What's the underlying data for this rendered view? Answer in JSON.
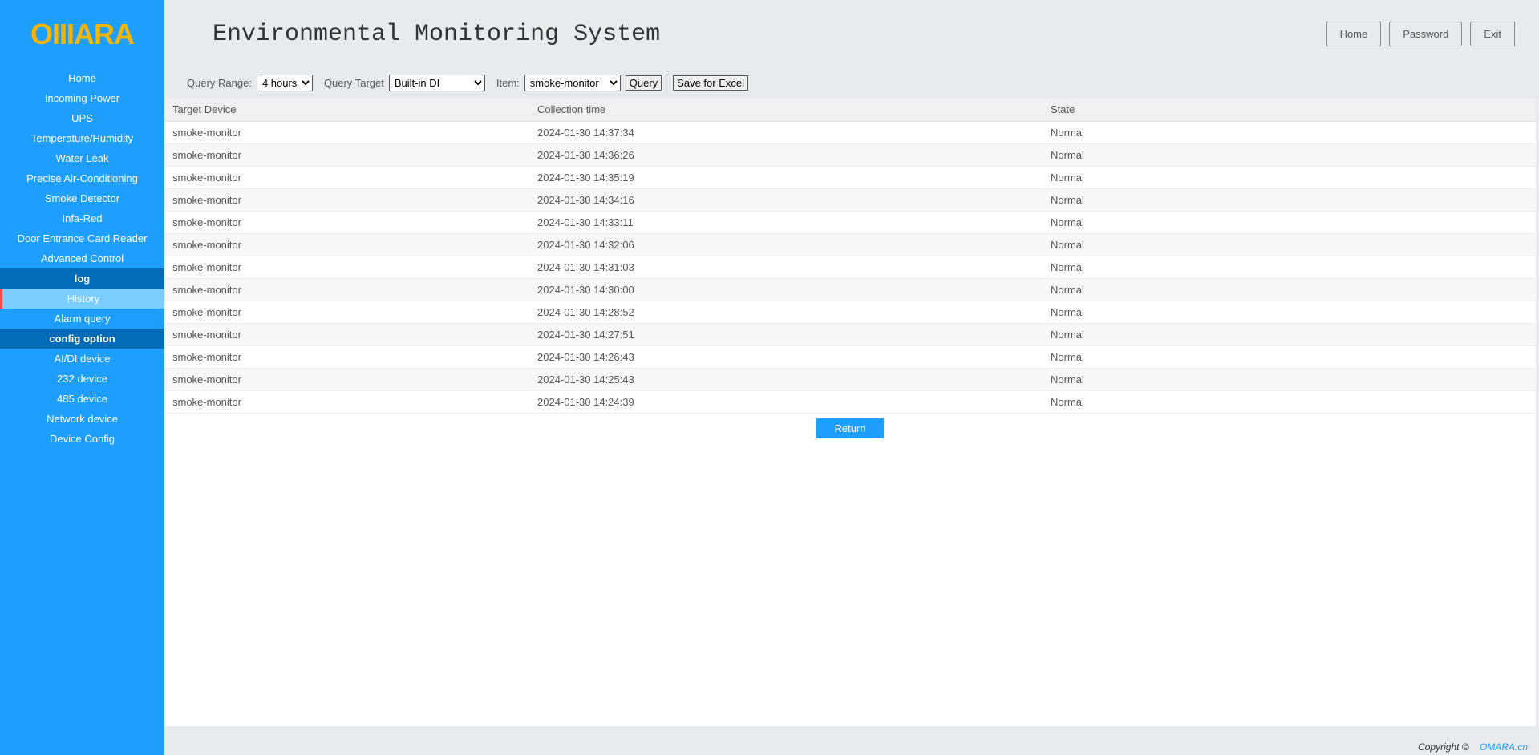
{
  "logo_text": "OIIIARA",
  "page_title": "Environmental Monitoring System",
  "header_buttons": {
    "home": "Home",
    "password": "Password",
    "exit": "Exit"
  },
  "sidebar": {
    "items": [
      {
        "label": "Home",
        "type": "item"
      },
      {
        "label": "Incoming Power",
        "type": "item"
      },
      {
        "label": "UPS",
        "type": "item"
      },
      {
        "label": "Temperature/Humidity",
        "type": "item"
      },
      {
        "label": "Water Leak",
        "type": "item"
      },
      {
        "label": "Precise Air-Conditioning",
        "type": "item"
      },
      {
        "label": "Smoke Detector",
        "type": "item"
      },
      {
        "label": "Infa-Red",
        "type": "item"
      },
      {
        "label": "Door Entrance Card Reader",
        "type": "item"
      },
      {
        "label": "Advanced Control",
        "type": "item"
      },
      {
        "label": "log",
        "type": "section"
      },
      {
        "label": "History",
        "type": "active"
      },
      {
        "label": "Alarm query",
        "type": "item"
      },
      {
        "label": "config option",
        "type": "section"
      },
      {
        "label": "AI/DI device",
        "type": "item"
      },
      {
        "label": "232 device",
        "type": "item"
      },
      {
        "label": "485 device",
        "type": "item"
      },
      {
        "label": "Network device",
        "type": "item"
      },
      {
        "label": "Device Config",
        "type": "item"
      }
    ]
  },
  "query": {
    "range_label": "Query Range:",
    "range_value": "4 hours",
    "target_label": "Query Target",
    "target_value": "Built-in DI",
    "item_label": "Item:",
    "item_value": "smoke-monitor",
    "query_btn": "Query",
    "save_btn": "Save for Excel"
  },
  "table": {
    "headers": {
      "device": "Target Device",
      "time": "Collection time",
      "state": "State"
    },
    "rows": [
      {
        "device": "smoke-monitor",
        "time": "2024-01-30 14:37:34",
        "state": "Normal"
      },
      {
        "device": "smoke-monitor",
        "time": "2024-01-30 14:36:26",
        "state": "Normal"
      },
      {
        "device": "smoke-monitor",
        "time": "2024-01-30 14:35:19",
        "state": "Normal"
      },
      {
        "device": "smoke-monitor",
        "time": "2024-01-30 14:34:16",
        "state": "Normal"
      },
      {
        "device": "smoke-monitor",
        "time": "2024-01-30 14:33:11",
        "state": "Normal"
      },
      {
        "device": "smoke-monitor",
        "time": "2024-01-30 14:32:06",
        "state": "Normal"
      },
      {
        "device": "smoke-monitor",
        "time": "2024-01-30 14:31:03",
        "state": "Normal"
      },
      {
        "device": "smoke-monitor",
        "time": "2024-01-30 14:30:00",
        "state": "Normal"
      },
      {
        "device": "smoke-monitor",
        "time": "2024-01-30 14:28:52",
        "state": "Normal"
      },
      {
        "device": "smoke-monitor",
        "time": "2024-01-30 14:27:51",
        "state": "Normal"
      },
      {
        "device": "smoke-monitor",
        "time": "2024-01-30 14:26:43",
        "state": "Normal"
      },
      {
        "device": "smoke-monitor",
        "time": "2024-01-30 14:25:43",
        "state": "Normal"
      },
      {
        "device": "smoke-monitor",
        "time": "2024-01-30 14:24:39",
        "state": "Normal"
      }
    ]
  },
  "return_btn": "Return",
  "footer": {
    "copyright": "Copyright ©",
    "link": "OMARA.cn"
  }
}
